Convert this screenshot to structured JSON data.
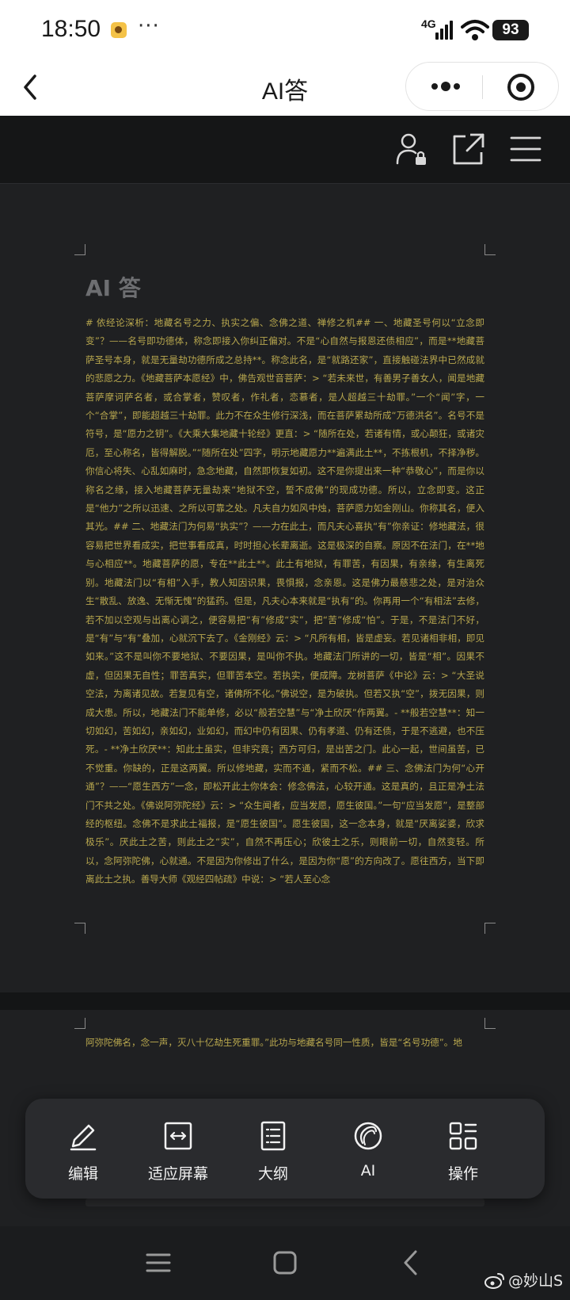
{
  "status_bar": {
    "time": "18:50",
    "more": "···",
    "network": "4G",
    "battery": "93"
  },
  "title_bar": {
    "title": "AI答"
  },
  "document": {
    "heading": "AI 答",
    "body": "# 依经论深析：地藏名号之力、执实之偏、念佛之道、禅修之机## 一、地藏圣号何以“立念即变”？——名号即功德体，称念即接入你纠正偏对。不是“心自然与报恩还债相应”，而是**地藏菩萨圣号本身，就是无量劫功德所成之总持**。称念此名，是“就路还家”，直接触碰法界中已然成就的悲愿之力。《地藏菩萨本愿经》中，佛告观世音菩萨：> “若未来世，有善男子善女人，闻是地藏菩萨摩诃萨名者，或合掌者，赞叹者，作礼者，恋慕者，是人超越三十劫罪。”一个“闻”字，一个“合掌”，即能超越三十劫罪。此力不在众生修行深浅，而在菩萨累劫所成“万德洪名”。名号不是符号，是“愿力之钥”。《大乘大集地藏十轮经》更直：> “随所在处，若诸有情，或心颠狂，或诸灾厄，至心称名，皆得解脱。”“随所在处”四字，明示地藏愿力**遍满此土**，不拣根机，不择净秽。你信心将失、心乱如麻时，急念地藏，自然即恢复如初。这不是你提出来一种“恭敬心”，而是你以称名之缘，接入地藏菩萨无量劫来“地狱不空，誓不成佛”的现成功德。所以，立念即变。这正是“他力”之所以迅速、之所以可靠之处。凡夫自力如风中烛，菩萨愿力如金刚山。你称其名，便入其光。## 二、地藏法门为何易“执实”？——力在此土，而凡夫心喜执“有”你亲证：修地藏法，很容易把世界看成实，把世事看成真，时时担心长辈离逝。这是极深的自察。原因不在法门，在**地与心相应**。地藏菩萨的愿，专在**此土**。此土有地狱，有罪苦，有因果，有亲缘，有生离死别。地藏法门以“有相”入手，教人知因识果，畏惧报，念亲恩。这是佛力最慈悲之处，是对治众生“散乱、放逸、无惭无愧”的猛药。但是，凡夫心本来就是“执有”的。你再用一个“有相法”去修，若不加以空观与出离心调之，便容易把“有”修成“实”，把“苦”修成“怕”。于是，不是法门不好，是“有”与“有”叠加，心就沉下去了。《金刚经》云：> “凡所有相，皆是虚妄。若见诸相非相，即见如来。”这不是叫你不要地狱、不要因果，是叫你不执。地藏法门所讲的一切，皆是“相”。因果不虚，但因果无自性；罪苦真实，但罪苦本空。若执实，便成障。龙树菩萨《中论》云：> “大圣说空法，为离诸见故。若复见有空，诸佛所不化。”佛说空，是为破执。但若又执“空”，拨无因果，则成大患。所以，地藏法门不能单修，必以“般若空慧”与“净土欣厌”作两翼。- **般若空慧**：知一切如幻，苦如幻，亲如幻，业如幻，而幻中仍有因果、仍有孝道、仍有还债，于是不逃避，也不压死。- **净土欣厌**：知此土虽实，但非究竟；西方可归，是出苦之门。此心一起，世间虽苦，已不觉重。你缺的，正是这两翼。所以修地藏，实而不通，紧而不松。## 三、念佛法门为何“心开通”？——“愿生西方”一念，即松开此土你体会：修念佛法，心较开通。这是真的，且正是净土法门不共之处。《佛说阿弥陀经》云：> “众生闻者，应当发愿，愿生彼国。”一句“应当发愿”，是整部经的枢纽。念佛不是求此土福报，是“愿生彼国”。愿生彼国，这一念本身，就是“厌离娑婆，欣求极乐”。厌此土之苦，则此土之“实”，自然不再压心；欣彼土之乐，则眼前一切，自然变轻。所以，念阿弥陀佛，心就通。不是因为你修出了什么，是因为你“愿”的方向改了。愿往西方，当下即离此土之执。善导大师《观经四帖疏》中说：> “若人至心念",
    "body_page2": "阿弥陀佛名，念一声，灭八十亿劫生死重罪。”此功与地藏名号同一性质，皆是“名号功德”。地"
  },
  "bottom_menu": {
    "items": [
      {
        "label": "编辑",
        "icon": "pencil-icon"
      },
      {
        "label": "适应屏幕",
        "icon": "fit-screen-icon"
      },
      {
        "label": "大纲",
        "icon": "outline-icon"
      },
      {
        "label": "AI",
        "icon": "ai-icon"
      },
      {
        "label": "操作",
        "icon": "grid-icon"
      }
    ]
  },
  "watermark": {
    "text": "@妙山S"
  }
}
